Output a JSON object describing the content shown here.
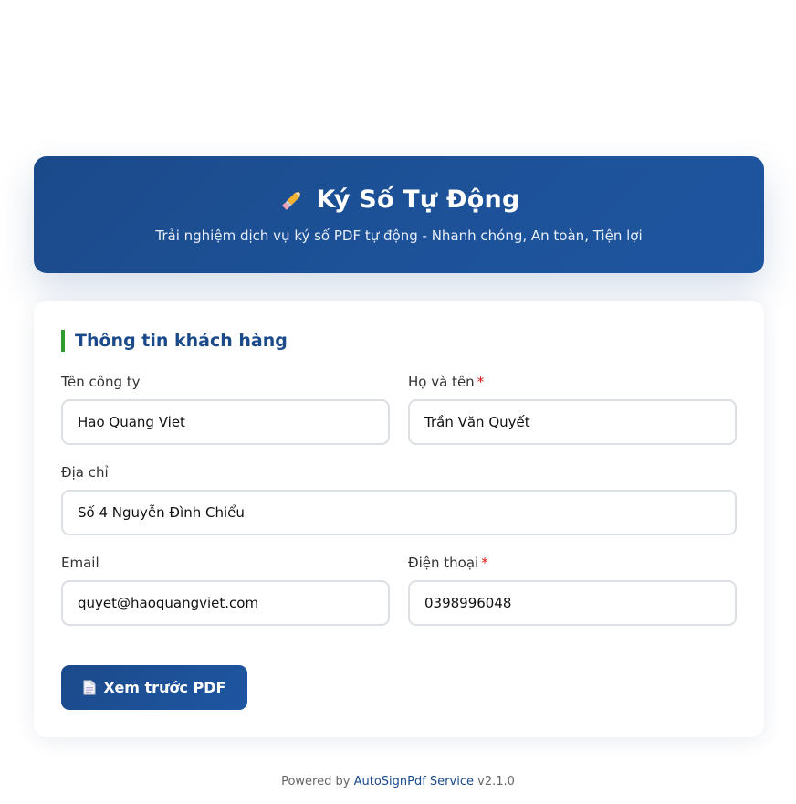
{
  "header": {
    "title": "Ký Số Tự Động",
    "subtitle": "Trải nghiệm dịch vụ ký số PDF tự động - Nhanh chóng, An toàn, Tiện lợi",
    "icon": "pen-icon"
  },
  "form": {
    "section_title": "Thông tin khách hàng",
    "company": {
      "label": "Tên công ty",
      "value": "Hao Quang Viet"
    },
    "fullname": {
      "label": "Họ và tên",
      "required_mark": "*",
      "value": "Trần Văn Quyết"
    },
    "address": {
      "label": "Địa chỉ",
      "value": "Số 4 Nguyễn Đình Chiểu"
    },
    "email": {
      "label": "Email",
      "value": "quyet@haoquangviet.com"
    },
    "phone": {
      "label": "Điện thoại",
      "required_mark": "*",
      "value": "0398996048"
    },
    "preview_button": {
      "label": "Xem trước PDF",
      "icon": "document-icon"
    }
  },
  "footer": {
    "prefix": "Powered by",
    "brand": "AutoSignPdf Service",
    "version": "v2.1.0"
  },
  "colors": {
    "primary": "#1b4a8a",
    "accent_bar": "#2e9b2e",
    "required": "#dd1111"
  }
}
